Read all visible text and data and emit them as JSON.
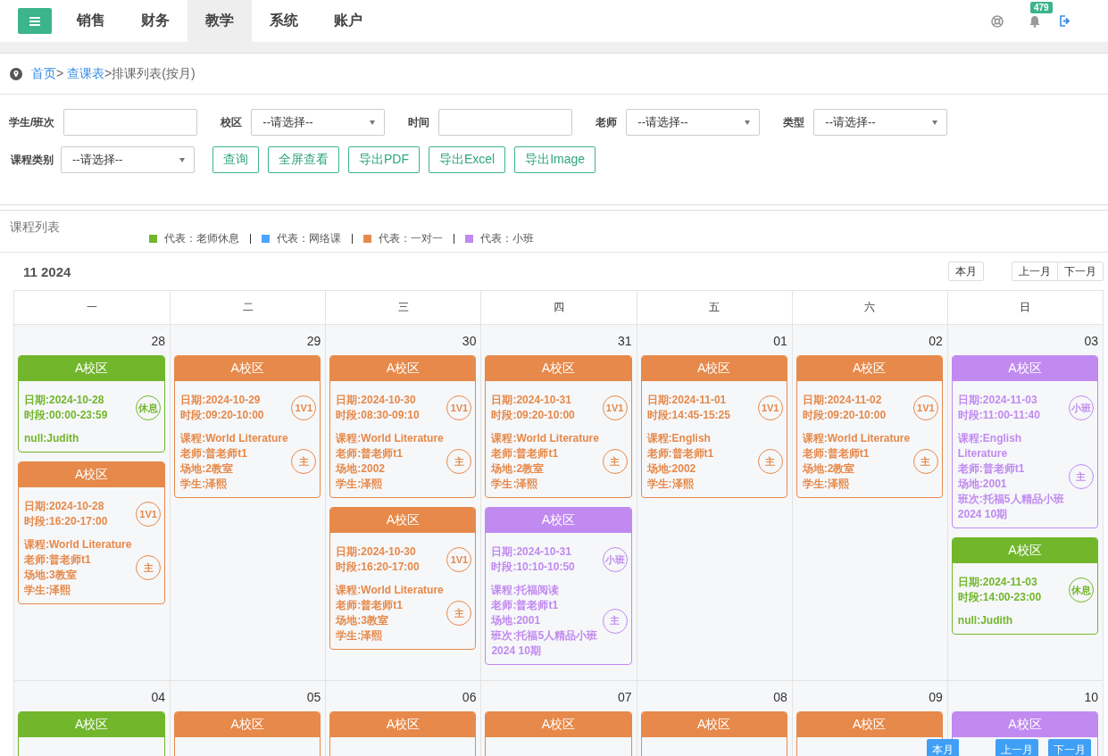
{
  "nav": {
    "tabs": [
      {
        "label": "销售",
        "selected": false
      },
      {
        "label": "财务",
        "selected": false
      },
      {
        "label": "教学",
        "selected": true
      },
      {
        "label": "系统",
        "selected": false
      },
      {
        "label": "账户",
        "selected": false
      }
    ],
    "notification_count": "479"
  },
  "breadcrumb": [
    {
      "label": "首页",
      "link": true
    },
    {
      "label": "> ",
      "link": false
    },
    {
      "label": "查课表",
      "link": true
    },
    {
      "label": ">排课列表(按月)",
      "link": false
    }
  ],
  "filters": [
    {
      "label": "学生/班次",
      "kind": "text"
    },
    {
      "label": "校区",
      "kind": "select",
      "value": "--请选择--"
    },
    {
      "label": "时间",
      "kind": "text"
    },
    {
      "label": "老师",
      "kind": "select",
      "value": "--请选择--"
    },
    {
      "label": "类型",
      "kind": "select",
      "value": "--请选择--"
    },
    {
      "label": "课程类别",
      "kind": "select",
      "value": "--请选择--"
    }
  ],
  "actions": [
    "查询",
    "全屏查看",
    "导出PDF",
    "导出Excel",
    "导出Image"
  ],
  "section_title": "课程列表",
  "legend": [
    {
      "label": "代表：老师休息",
      "color": "#72b62c"
    },
    {
      "label": "代表：网络课",
      "color": "#4da3ff"
    },
    {
      "label": "代表：一对一",
      "color": "#e6894a"
    },
    {
      "label": "代表：小班",
      "color": "#c08af0"
    }
  ],
  "calendar": {
    "title": "11 2024",
    "today_button": "本月",
    "prev_button": "上一月",
    "next_button": "下一月",
    "weekdays": [
      "一",
      "二",
      "三",
      "四",
      "五",
      "六",
      "日"
    ],
    "weeks": [
      {
        "days": [
          {
            "day": "28",
            "events": [
              {
                "kind": "rest",
                "campus": "A校区",
                "date": "日期:2024-10-28",
                "time": "时段:00:00-23:59",
                "badge": "休息",
                "lines": [
                  "null:Judith"
                ]
              },
              {
                "kind": "one_on_one",
                "campus": "A校区",
                "date": "日期:2024-10-28",
                "time": "时段:16:20-17:00",
                "badge": "1V1",
                "role": "主",
                "lines": [
                  "课程:World Literature",
                  "老师:普老师t1",
                  "场地:3教室",
                  "学生:泽熙"
                ]
              }
            ]
          },
          {
            "day": "29",
            "events": [
              {
                "kind": "one_on_one",
                "campus": "A校区",
                "date": "日期:2024-10-29",
                "time": "时段:09:20-10:00",
                "badge": "1V1",
                "role": "主",
                "lines": [
                  "课程:World Literature",
                  "老师:普老师t1",
                  "场地:2教室",
                  "学生:泽熙"
                ]
              }
            ]
          },
          {
            "day": "30",
            "events": [
              {
                "kind": "one_on_one",
                "campus": "A校区",
                "date": "日期:2024-10-30",
                "time": "时段:08:30-09:10",
                "badge": "1V1",
                "role": "主",
                "lines": [
                  "课程:World Literature",
                  "老师:普老师t1",
                  "场地:2002",
                  "学生:泽熙"
                ]
              },
              {
                "kind": "one_on_one",
                "campus": "A校区",
                "date": "日期:2024-10-30",
                "time": "时段:16:20-17:00",
                "badge": "1V1",
                "role": "主",
                "lines": [
                  "课程:World Literature",
                  "老师:普老师t1",
                  "场地:3教室",
                  "学生:泽熙"
                ]
              }
            ]
          },
          {
            "day": "31",
            "events": [
              {
                "kind": "one_on_one",
                "campus": "A校区",
                "date": "日期:2024-10-31",
                "time": "时段:09:20-10:00",
                "badge": "1V1",
                "role": "主",
                "lines": [
                  "课程:World Literature",
                  "老师:普老师t1",
                  "场地:2教室",
                  "学生:泽熙"
                ]
              },
              {
                "kind": "small_class",
                "campus": "A校区",
                "date": "日期:2024-10-31",
                "time": "时段:10:10-10:50",
                "badge": "小班",
                "role": "主",
                "lines": [
                  "课程:托福阅读",
                  "老师:普老师t1",
                  "场地:2001",
                  "班次:托福5人精品小班2024 10期"
                ]
              }
            ]
          },
          {
            "day": "01",
            "events": [
              {
                "kind": "one_on_one",
                "campus": "A校区",
                "date": "日期:2024-11-01",
                "time": "时段:14:45-15:25",
                "badge": "1V1",
                "role": "主",
                "lines": [
                  "课程:English",
                  "老师:普老师t1",
                  "场地:2002",
                  "学生:泽熙"
                ]
              }
            ]
          },
          {
            "day": "02",
            "events": [
              {
                "kind": "one_on_one",
                "campus": "A校区",
                "date": "日期:2024-11-02",
                "time": "时段:09:20-10:00",
                "badge": "1V1",
                "role": "主",
                "lines": [
                  "课程:World Literature",
                  "老师:普老师t1",
                  "场地:2教室",
                  "学生:泽熙"
                ]
              }
            ]
          },
          {
            "day": "03",
            "events": [
              {
                "kind": "small_class",
                "campus": "A校区",
                "date": "日期:2024-11-03",
                "time": "时段:11:00-11:40",
                "badge": "小班",
                "role": "主",
                "lines": [
                  "课程:English Literature",
                  "老师:普老师t1",
                  "场地:2001",
                  "班次:托福5人精品小班2024 10期"
                ]
              },
              {
                "kind": "rest",
                "campus": "A校区",
                "date": "日期:2024-11-03",
                "time": "时段:14:00-23:00",
                "badge": "休息",
                "lines": [
                  "null:Judith"
                ]
              }
            ]
          }
        ]
      },
      {
        "days": [
          {
            "day": "04",
            "events": [
              {
                "kind": "rest",
                "campus": "A校区"
              }
            ]
          },
          {
            "day": "05",
            "events": [
              {
                "kind": "one_on_one",
                "campus": "A校区"
              }
            ]
          },
          {
            "day": "06",
            "events": [
              {
                "kind": "one_on_one",
                "campus": "A校区"
              }
            ]
          },
          {
            "day": "07",
            "events": [
              {
                "kind": "one_on_one",
                "campus": "A校区"
              }
            ]
          },
          {
            "day": "08",
            "events": [
              {
                "kind": "one_on_one",
                "campus": "A校区"
              }
            ]
          },
          {
            "day": "09",
            "events": [
              {
                "kind": "one_on_one",
                "campus": "A校区"
              }
            ]
          },
          {
            "day": "10",
            "events": [
              {
                "kind": "small_class",
                "campus": "A校区"
              }
            ]
          }
        ]
      }
    ]
  },
  "floating_buttons": [
    "本月",
    "上一月",
    "下一月"
  ]
}
